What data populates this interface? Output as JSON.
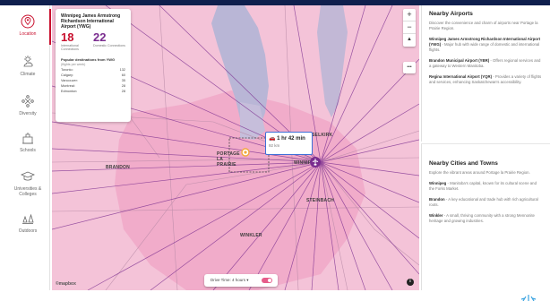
{
  "sidebar": {
    "items": [
      {
        "label": "Location",
        "icon": "location-pin-icon",
        "active": true
      },
      {
        "label": "Climate",
        "icon": "sun-cloud-icon"
      },
      {
        "label": "Diversity",
        "icon": "diversity-icon"
      },
      {
        "label": "Schools",
        "icon": "school-icon"
      },
      {
        "label": "Universities & Colleges",
        "icon": "graduation-cap-icon"
      },
      {
        "label": "Outdoors",
        "icon": "outdoors-icon"
      }
    ]
  },
  "info_card": {
    "airport_name": "Winnipeg James Armstrong Richardson International Airport (YWG)",
    "international_count": "18",
    "international_label": "International Connections",
    "domestic_count": "22",
    "domestic_label": "Domestic Connections",
    "destinations_title": "Popular destinations from YWG",
    "destinations_subtitle": "(flights per week)",
    "destinations": [
      {
        "city": "Toronto:",
        "flights": "132"
      },
      {
        "city": "Calgary:",
        "flights": "60"
      },
      {
        "city": "Vancouver:",
        "flights": "35"
      },
      {
        "city": "Montreal:",
        "flights": "28"
      },
      {
        "city": "Edmonton:",
        "flights": "28"
      }
    ]
  },
  "map": {
    "labels": {
      "selkirk": "SELKIRK",
      "portage": "PORTAGE LA PRAIRIE",
      "winnipeg": "WINNIPEG",
      "brandon": "BRANDON",
      "steinbach": "STEINBACH",
      "winkler": "WINKLER"
    },
    "drive_time": "1 hr 42 min",
    "drive_distance": "92 km",
    "drive_toggle_label": "Drive Time: 4 hours ▾",
    "attribution": "©mapbox",
    "controls": {
      "zoom_in": "+",
      "zoom_out": "−",
      "compass": "▲",
      "menu": "•••"
    },
    "info_button": "i",
    "colors": {
      "land": "#f4c3d8",
      "lake": "#b9b6d6",
      "route": "#7a2c8f",
      "drive_border": "#3f6fd8"
    }
  },
  "airports_panel": {
    "title": "Nearby Airports",
    "description": "Discover the convenience and charm of airports near Portage la Prairie Region.",
    "items": [
      {
        "name": "Winnipeg James Armstrong Richardson International Airport (YWG)",
        "text": "- Major hub with wide range of domestic and international flights."
      },
      {
        "name": "Brandon Municipal Airport (YBR)",
        "text": "- Offers regional services and a gateway to Western Manitoba."
      },
      {
        "name": "Regina International Airport (YQR)",
        "text": "- Provides a variety of flights and services, enhancing Saskatchewan's accessibility."
      }
    ]
  },
  "cities_panel": {
    "title": "Nearby Cities and Towns",
    "description": "Explore the vibrant areas around Portage la Prairie Region.",
    "items": [
      {
        "name": "Winnipeg",
        "text": "- Manitoba's capital, known for its cultural scene and the Forks Market."
      },
      {
        "name": "Brandon",
        "text": "- A key educational and trade hub with rich agricultural roots."
      },
      {
        "name": "Winkler",
        "text": "- A small, thriving community with a strong Mennonite heritage and growing industries."
      }
    ]
  }
}
